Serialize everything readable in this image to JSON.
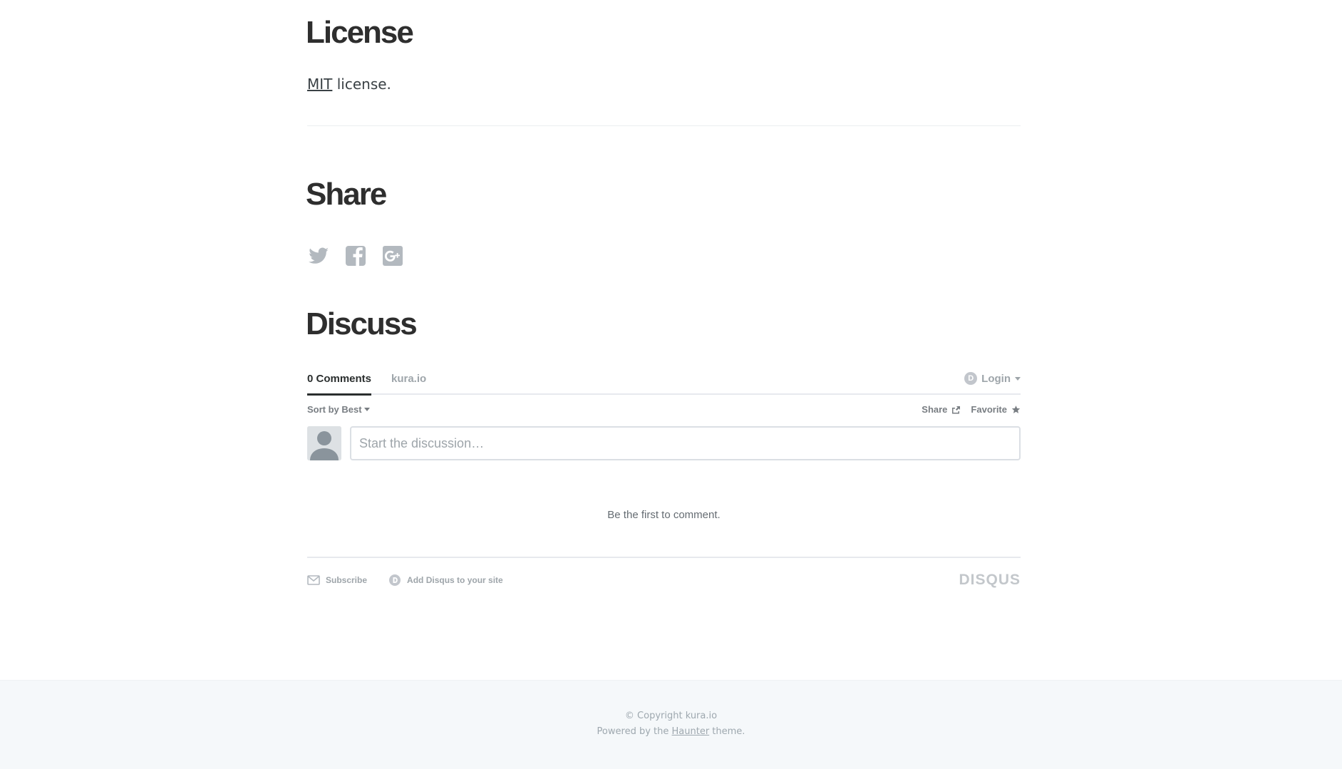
{
  "license": {
    "title": "License",
    "link_text": "MIT",
    "text_suffix": " license."
  },
  "share": {
    "title": "Share",
    "icons": [
      "twitter-icon",
      "facebook-icon",
      "google-plus-icon"
    ],
    "icon_color": "#b3b9bf"
  },
  "discuss": {
    "title": "Discuss"
  },
  "disqus": {
    "tabs": {
      "comments": "0 Comments",
      "site": "kura.io"
    },
    "login": {
      "logo": "D",
      "label": "Login"
    },
    "sort_label": "Sort by Best",
    "share_label": "Share",
    "favorite_label": "Favorite",
    "input_placeholder": "Start the discussion…",
    "empty_message": "Be the first to comment.",
    "footer": {
      "subscribe": "Subscribe",
      "add_disqus": "Add Disqus to your site",
      "brand": "DISQUS"
    }
  },
  "site_footer": {
    "copyright": "© Copyright kura.io",
    "powered_prefix": "Powered by the ",
    "powered_link": "Haunter",
    "powered_suffix": " theme."
  },
  "colors": {
    "heading": "#2e2e2e",
    "text": "#3a4145",
    "muted": "#9ea5aa",
    "footer_bg": "#f5f8fa"
  }
}
